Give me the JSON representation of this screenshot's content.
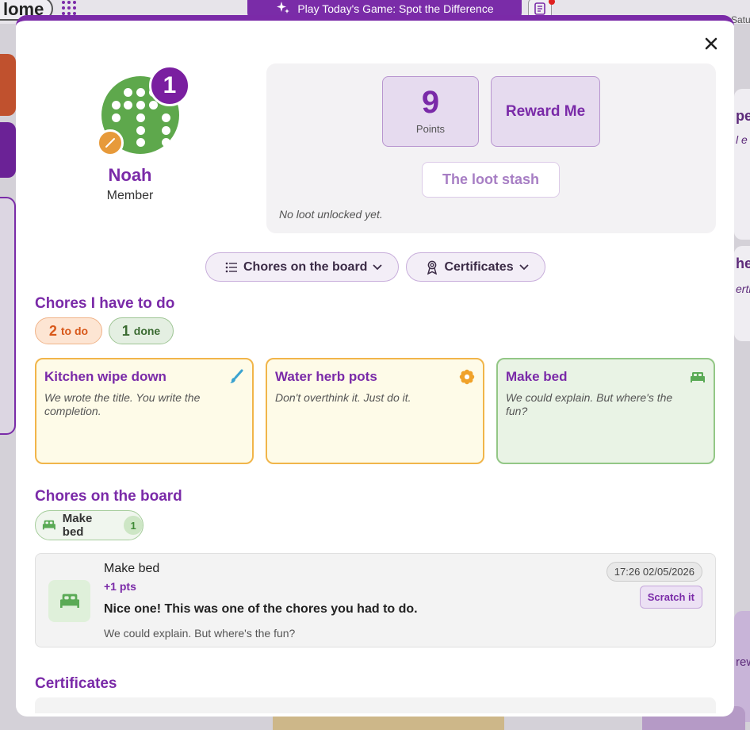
{
  "background": {
    "home_label": "lome",
    "play_label": "Play Today's Game: Spot the Difference",
    "date_fragment": "Satu",
    "right_fragment_1": "pe",
    "right_fragment_2": "l e",
    "right_fragment_3": "he",
    "right_fragment_4": "erth",
    "right_fragment_5": "rew"
  },
  "profile": {
    "name": "Noah",
    "role": "Member",
    "level_badge": "1",
    "avatar_color": "#5ea84c"
  },
  "points": {
    "value": "9",
    "label": "Points",
    "reward_label": "Reward Me",
    "loot_label": "The loot stash",
    "loot_note": "No loot unlocked yet."
  },
  "jump": {
    "board_label": "Chores on the board",
    "certificates_label": "Certificates"
  },
  "todo_section": {
    "title": "Chores I have to do",
    "todo_count": "2",
    "todo_label": "to do",
    "done_count": "1",
    "done_label": "done",
    "cards": [
      {
        "title": "Kitchen wipe down",
        "desc": "We wrote the title. You write the completion.",
        "icon": "brush-icon"
      },
      {
        "title": "Water herb pots",
        "desc": "Don't overthink it. Just do it.",
        "icon": "flower-icon"
      },
      {
        "title": "Make bed",
        "desc": "We could explain. But where's the fun?",
        "icon": "bed-icon"
      }
    ]
  },
  "board_section": {
    "title": "Chores on the board",
    "chip_label": "Make bed",
    "chip_count": "1",
    "entry": {
      "title": "Make bed",
      "points": "+1 pts",
      "message": "Nice one! This was one of the chores you had to do.",
      "desc": "We could explain. But where's the fun?",
      "timestamp": "17:26 02/05/2026",
      "scratch_label": "Scratch it"
    }
  },
  "certificates_section": {
    "title": "Certificates"
  },
  "colors": {
    "accent": "#7a2aa8",
    "todo": "#d8581a",
    "done": "#3b6b32",
    "yellow_card": "#f1b54a",
    "green_card": "#93c786"
  }
}
